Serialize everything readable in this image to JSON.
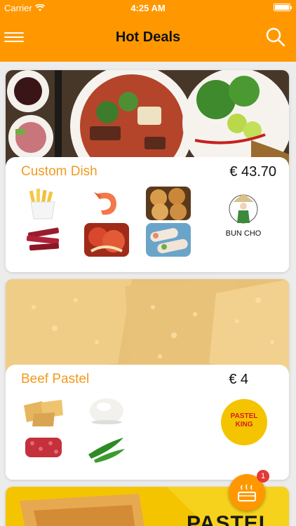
{
  "status_bar": {
    "carrier": "Carrier",
    "time": "4:25 AM"
  },
  "header": {
    "title": "Hot Deals",
    "menu_icon": "hamburger-menu-icon",
    "search_icon": "search-icon"
  },
  "deals": [
    {
      "name": "Custom Dish",
      "price": "€ 43.70",
      "restaurant_logo_text": "BUN CHO",
      "items": [
        "french fries",
        "shrimp",
        "spring rolls",
        "beef jerky",
        "kimchi",
        "rice paper rolls"
      ]
    },
    {
      "name": "Beef Pastel",
      "price": "€ 4",
      "restaurant_logo_text": "PASTEL KING",
      "items": [
        "pastel",
        "dough ball",
        "minced beef",
        "green peppers"
      ]
    },
    {
      "banner_text": "PASTEL"
    }
  ],
  "cart": {
    "icon": "food-tray-icon",
    "count": "1"
  },
  "colors": {
    "brand_orange": "#ff9800",
    "dish_name": "#f29a1e",
    "badge": "#e53935"
  }
}
